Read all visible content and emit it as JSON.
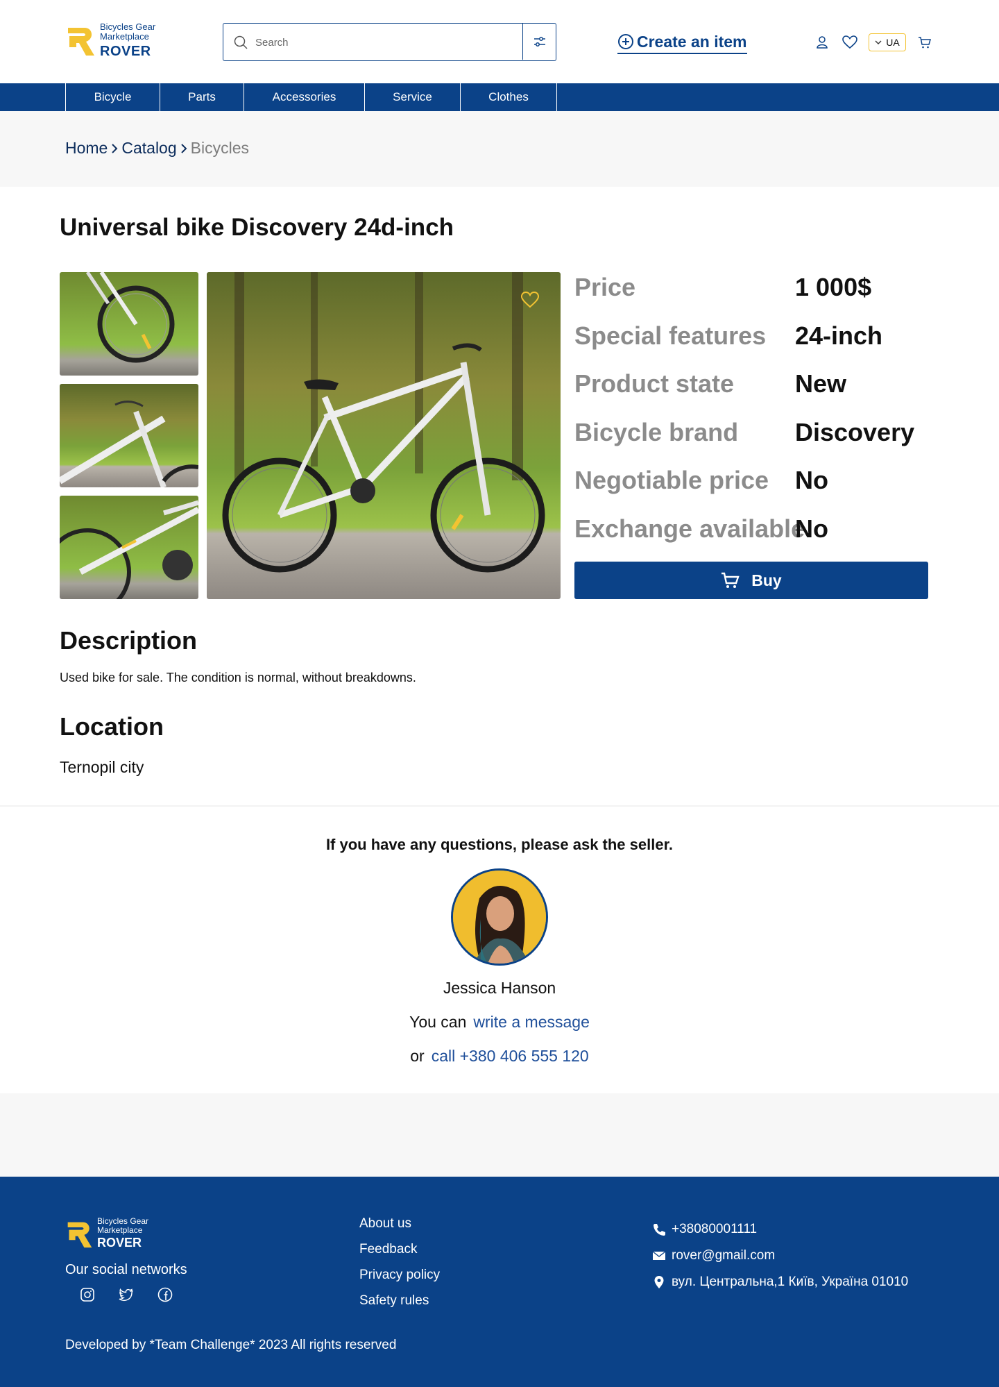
{
  "brand": {
    "line1": "Bicycles Gear",
    "line2": "Marketplace",
    "name": "ROVER",
    "color": "#0b4288",
    "accent": "#f3c332"
  },
  "search": {
    "placeholder": "Search"
  },
  "header": {
    "create_label": "Create an item",
    "lang": "UA",
    "icons": [
      "user-icon",
      "heart-icon",
      "chevron-down-icon",
      "cart-icon"
    ]
  },
  "nav": [
    {
      "label": "Bicycle"
    },
    {
      "label": "Parts"
    },
    {
      "label": "Accessories"
    },
    {
      "label": "Service"
    },
    {
      "label": "Clothes"
    }
  ],
  "breadcrumb": {
    "home": "Home",
    "catalog": "Catalog",
    "current": "Bicycles"
  },
  "product": {
    "title": "Universal bike Discovery 24d-inch",
    "specs": [
      {
        "key": "Price",
        "value": "1 000$"
      },
      {
        "key": "Special features",
        "value": "24-inch"
      },
      {
        "key": "Product state",
        "value": "New"
      },
      {
        "key": "Bicycle brand",
        "value": "Discovery"
      },
      {
        "key": "Negotiable price",
        "value": "No"
      },
      {
        "key": "Exchange available",
        "value": "No"
      }
    ],
    "buy_label": "Buy"
  },
  "description": {
    "heading": "Description",
    "text": "Used bike for sale. The condition is normal, without breakdowns."
  },
  "location": {
    "heading": "Location",
    "text": "Ternopil city"
  },
  "seller": {
    "prompt": "If you have any questions, please ask the seller.",
    "name": "Jessica Hanson",
    "msg_prefix": "You can",
    "msg_link": "write a message",
    "call_prefix": "or",
    "call_link": "call +380 406 555 120"
  },
  "footer": {
    "social_title": "Our social networks",
    "links": [
      "About us",
      "Feedback",
      "Privacy policy",
      "Safety rules"
    ],
    "phone": "+38080001111",
    "email": "rover@gmail.com",
    "address": "вул. Центральна,1 Київ, Україна 01010",
    "copyright": "Developed by *Team Challenge* 2023 All rights reserved"
  }
}
